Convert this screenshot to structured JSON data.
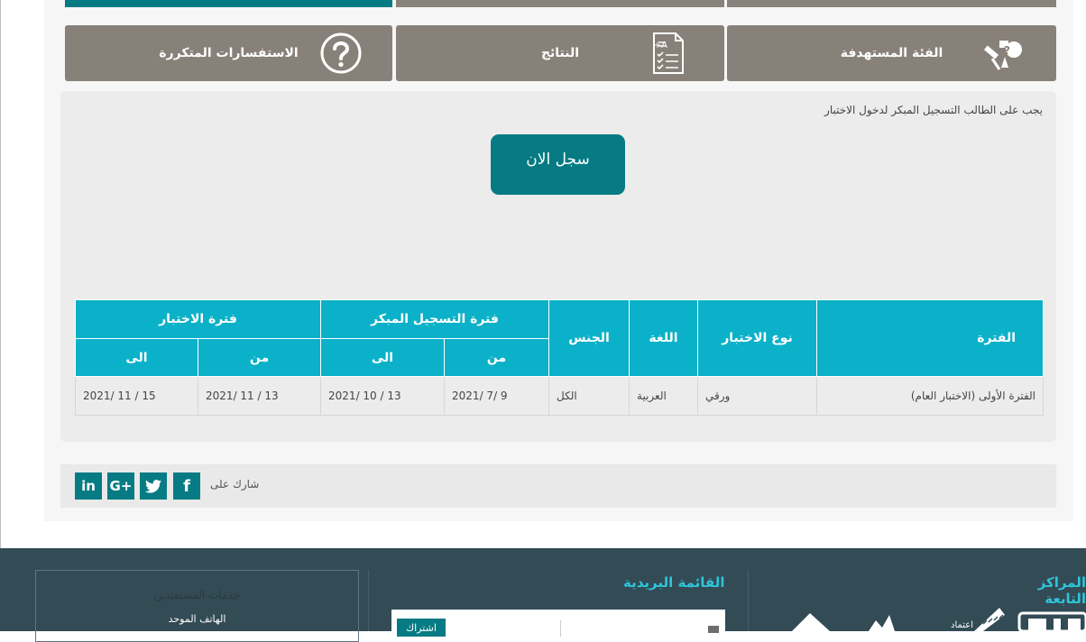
{
  "tabs": {
    "faq": "الاستفسارات المتكررة",
    "results": "النتائج",
    "target": "الفئة المستهدفة"
  },
  "notice": "يجب على الطالب التسجيل المبكر لدخول الاختبار",
  "register_label": "سجل الان",
  "table": {
    "headers": {
      "period": "الفترة",
      "test_type": "نوع الاختبار",
      "language": "اللغة",
      "gender": "الجنس",
      "early_reg": "فترة التسجيل المبكر",
      "test_period": "فترة الاختبار",
      "from": "من",
      "to": "الى"
    },
    "row": {
      "period": "الفترة الأولى (الاختبار العام)",
      "test_type": "ورقي",
      "language": "العربية",
      "gender": "الكل",
      "reg_from": "9 /7 /2021",
      "reg_to": "13 / 10 /2021",
      "test_from": "13 / 11 /2021",
      "test_to": "15 / 11 /2021"
    }
  },
  "share": {
    "label": "شارك على",
    "icons": [
      "facebook-icon",
      "twitter-icon",
      "google-plus-icon",
      "linkedin-icon"
    ],
    "facebook": "f",
    "google": "G+",
    "linkedin": "in"
  },
  "footer": {
    "centers_title": "المراكز التابعة",
    "newsletter_title": "القائمة البريدية",
    "newsletter_button": "اشتراك",
    "services_title": "خدمات المستفيدين",
    "services_item": "الهاتف الموحد",
    "logo_text": "اعتماد"
  },
  "colors": {
    "accent": "#067b84",
    "table_header": "#0bb1c8",
    "tab_bg": "#888179",
    "footer_bg": "#324b55",
    "footer_title": "#2ec5d8"
  }
}
